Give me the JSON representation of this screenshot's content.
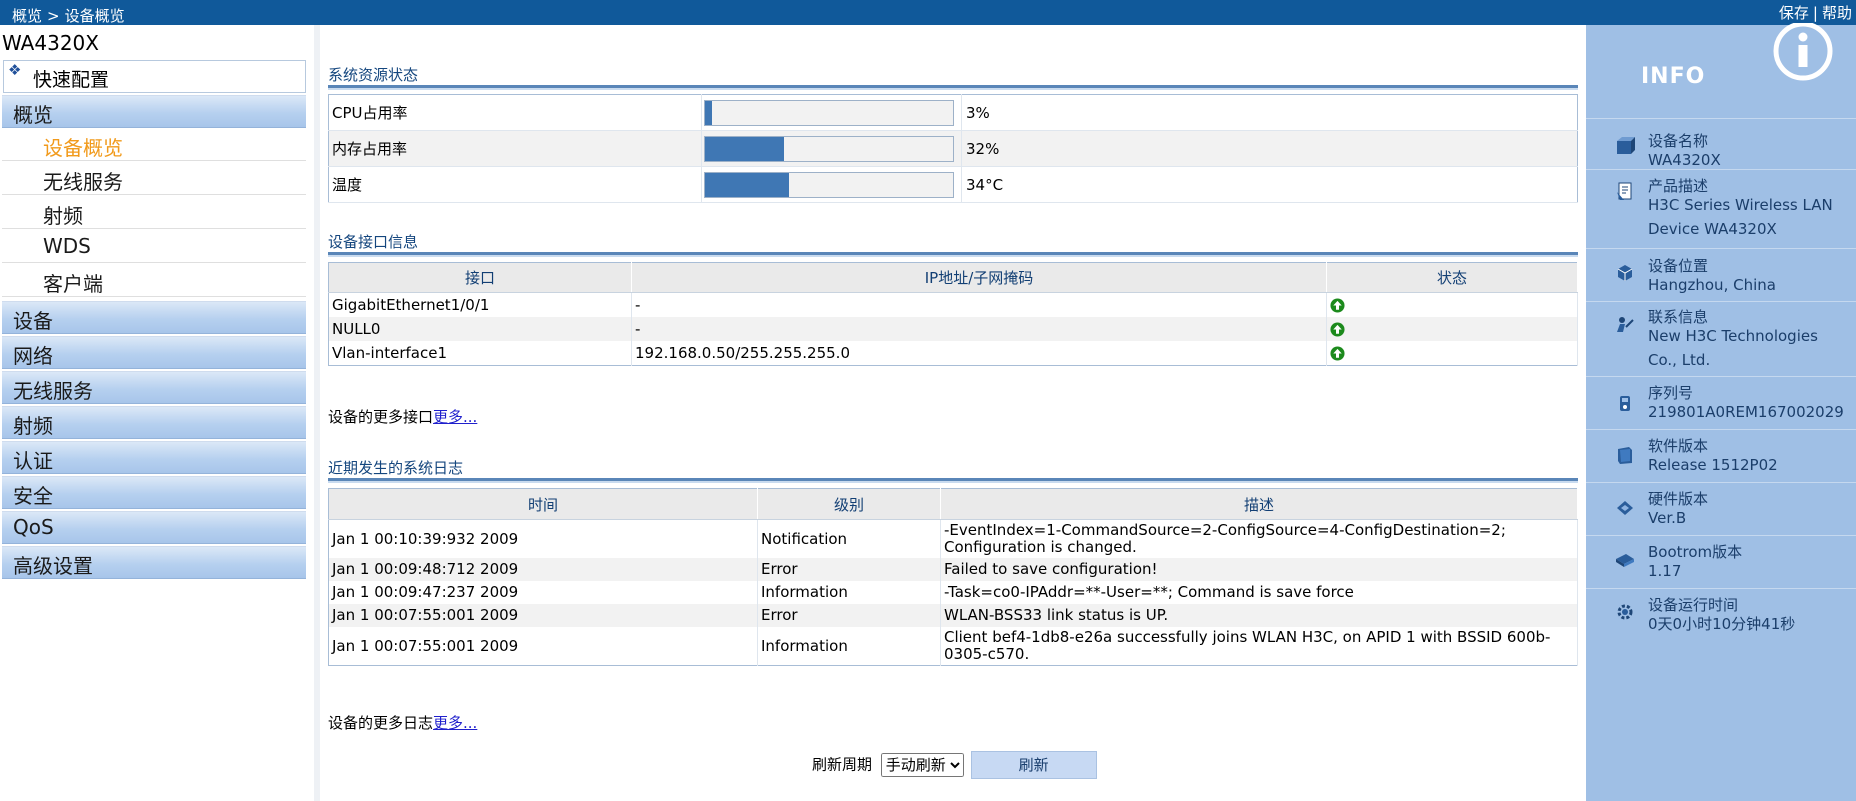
{
  "topbar": {
    "breadcrumb_root": "概览",
    "breadcrumb_sep": ">",
    "breadcrumb_current": "设备概览",
    "save_label": "保存",
    "separator": "|",
    "help_label": "帮助",
    "background": "#10599a"
  },
  "sidebar": {
    "device_name": "WA4320X",
    "quick_config": "快速配置",
    "groups": [
      {
        "label": "概览"
      },
      {
        "label": "设备"
      },
      {
        "label": "网络"
      },
      {
        "label": "无线服务"
      },
      {
        "label": "射频"
      },
      {
        "label": "认证"
      },
      {
        "label": "安全"
      },
      {
        "label": "QoS"
      },
      {
        "label": "高级设置"
      }
    ],
    "overview_items": [
      {
        "label": "设备概览",
        "active": true
      },
      {
        "label": "无线服务"
      },
      {
        "label": "射频"
      },
      {
        "label": "WDS"
      },
      {
        "label": "客户端"
      }
    ],
    "active_color": "#f19a1b"
  },
  "resources": {
    "title": "系统资源状态",
    "rows": [
      {
        "name": "CPU占用率",
        "value": "3%",
        "level": 0.03
      },
      {
        "name": "内存占用率",
        "value": "32%",
        "level": 0.32
      },
      {
        "name": "温度",
        "value": "34°C",
        "level": 0.34
      }
    ]
  },
  "interfaces": {
    "title": "设备接口信息",
    "headers": [
      "接口",
      "IP地址/子网掩码",
      "状态"
    ],
    "rows": [
      {
        "name": "GigabitEthernet1/0/1",
        "ip": "-",
        "status": "up-icon"
      },
      {
        "name": "NULL0",
        "ip": "-",
        "status": "up-icon"
      },
      {
        "name": "Vlan-interface1",
        "ip": "192.168.0.50/255.255.255.0",
        "status": "up-icon"
      }
    ],
    "more_text": "设备的更多接口",
    "more_link": "更多..."
  },
  "logs": {
    "title": "近期发生的系统日志",
    "headers": [
      "时间",
      "级别",
      "描述"
    ],
    "rows": [
      {
        "time": "Jan 1 00:10:39:932 2009",
        "level": "Notification",
        "desc": "-EventIndex=1-CommandSource=2-ConfigSource=4-ConfigDestination=2; Configuration is changed."
      },
      {
        "time": "Jan 1 00:09:48:712 2009",
        "level": "Error",
        "desc": "Failed to save configuration!"
      },
      {
        "time": "Jan 1 00:09:47:237 2009",
        "level": "Information",
        "desc": "-Task=co0-IPAddr=**-User=**; Command is save force"
      },
      {
        "time": "Jan 1 00:07:55:001 2009",
        "level": "Error",
        "desc": "WLAN-BSS33 link status is UP."
      },
      {
        "time": "Jan 1 00:07:55:001 2009",
        "level": "Information",
        "desc": "Client bef4-1db8-e26a successfully joins WLAN H3C, on APID 1 with BSSID 600b-0305-c570."
      }
    ],
    "more_text": "设备的更多日志",
    "more_link": "更多..."
  },
  "refresh": {
    "label": "刷新周期",
    "selected": "手动刷新",
    "button": "刷新"
  },
  "info": {
    "title": "INFO",
    "items": [
      {
        "key": "设备名称",
        "value": "WA4320X",
        "icon": "device-icon"
      },
      {
        "key": "产品描述",
        "value": "H3C Series Wireless LAN Device WA4320X",
        "icon": "description-icon"
      },
      {
        "key": "设备位置",
        "value": "Hangzhou, China",
        "icon": "location-icon"
      },
      {
        "key": "联系信息",
        "value": "New H3C Technologies Co., Ltd.",
        "icon": "contact-icon"
      },
      {
        "key": "序列号",
        "value": "219801A0REM167002029",
        "icon": "serial-icon"
      },
      {
        "key": "软件版本",
        "value": "Release 1512P02",
        "icon": "software-icon"
      },
      {
        "key": "硬件版本",
        "value": "Ver.B",
        "icon": "hardware-icon"
      },
      {
        "key": "Bootrom版本",
        "value": "1.17",
        "icon": "bootrom-icon"
      },
      {
        "key": "设备运行时间",
        "value": "0天0小时10分钟41秒",
        "icon": "uptime-icon"
      }
    ],
    "background": "#9fbfe5"
  }
}
